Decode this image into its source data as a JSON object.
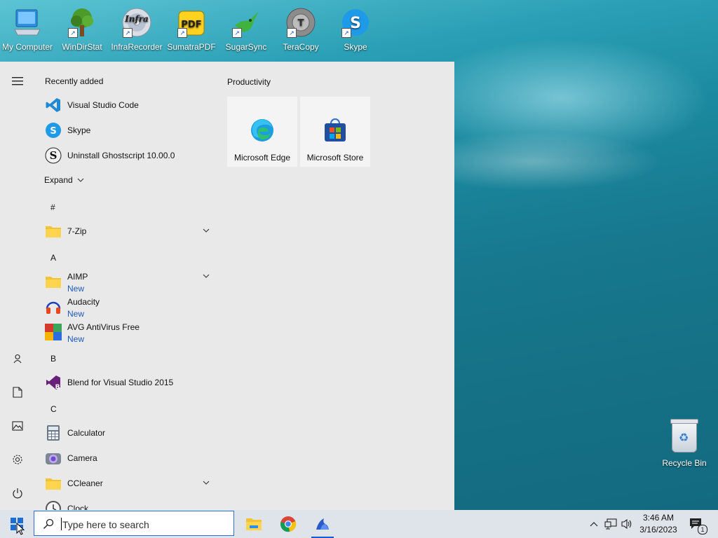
{
  "desktop": {
    "icons": [
      {
        "label": "My Computer"
      },
      {
        "label": "WinDirStat"
      },
      {
        "label": "InfraRecorder"
      },
      {
        "label": "SumatraPDF"
      },
      {
        "label": "SugarSync"
      },
      {
        "label": "TeraCopy"
      },
      {
        "label": "Skype"
      }
    ],
    "recycle_bin": "Recycle Bin"
  },
  "start_menu": {
    "recently_added_title": "Recently added",
    "recent": [
      {
        "name": "Visual Studio Code"
      },
      {
        "name": "Skype"
      },
      {
        "name": "Uninstall Ghostscript 10.00.0"
      }
    ],
    "expand_label": "Expand",
    "groups": {
      "hash": "#",
      "a": "A",
      "b": "B",
      "c": "C"
    },
    "apps": {
      "zip": "7-Zip",
      "aimp": "AIMP",
      "audacity": "Audacity",
      "avg": "AVG AntiVirus Free",
      "blend": "Blend for Visual Studio 2015",
      "calculator": "Calculator",
      "camera": "Camera",
      "ccleaner": "CCleaner",
      "clock": "Clock"
    },
    "new_tag": "New",
    "tiles": {
      "group_title": "Productivity",
      "edge": "Microsoft Edge",
      "store": "Microsoft Store"
    }
  },
  "taskbar": {
    "search_placeholder": "Type here to search",
    "time": "3:46 AM",
    "date": "3/16/2023",
    "notification_count": "1"
  }
}
